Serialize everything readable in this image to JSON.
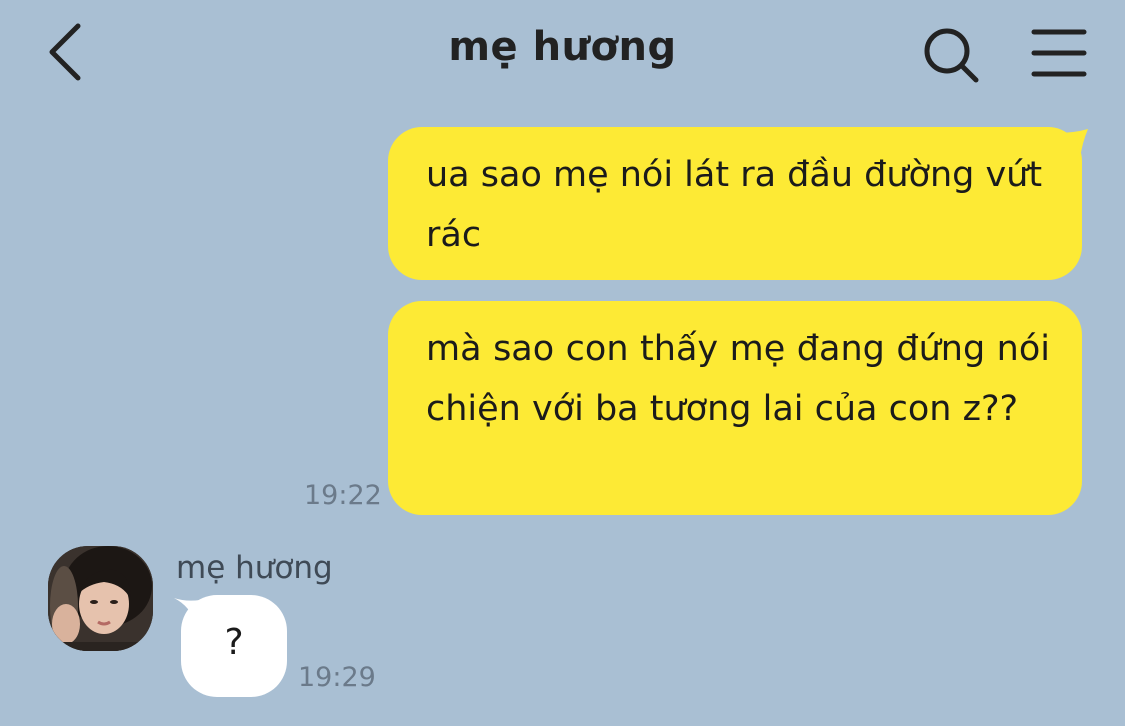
{
  "header": {
    "title": "mẹ hương",
    "back_icon": "chevron-left-icon",
    "search_icon": "search-icon",
    "menu_icon": "hamburger-menu-icon"
  },
  "messages": [
    {
      "direction": "outgoing",
      "text": "ua sao mẹ nói lát ra đầu đường vứt rác"
    },
    {
      "direction": "outgoing",
      "text": "mà sao con thấy mẹ đang đứng nói chiện với ba tương lai của con z??",
      "time": "19:22"
    },
    {
      "direction": "incoming",
      "sender": "mẹ hương",
      "text": "?",
      "time": "19:29"
    }
  ],
  "colors": {
    "background": "#a9bfd3",
    "outgoing_bubble": "#fdea35",
    "incoming_bubble": "#ffffff",
    "timestamp": "#6b7a8a"
  }
}
